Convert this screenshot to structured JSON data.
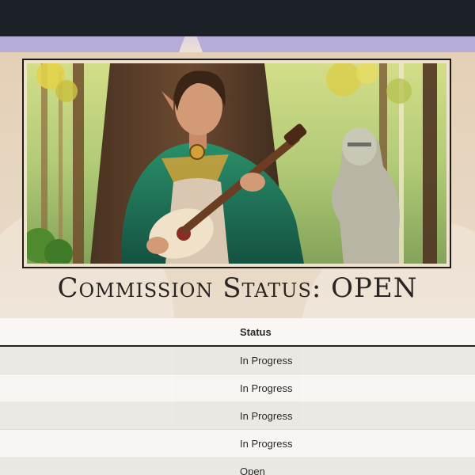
{
  "header": {
    "title": "Commission Status: OPEN"
  },
  "colors": {
    "topbar": "#1c2127",
    "accent_strip": "#b7abd8",
    "cloak_green": "#1f6b52",
    "gold": "#d2a238"
  },
  "illustration": {
    "description_icon": "bard-with-lute-illustration"
  },
  "table": {
    "columns": [
      "Status"
    ],
    "rows": [
      {
        "status": "In Progress"
      },
      {
        "status": "In Progress"
      },
      {
        "status": "In Progress"
      },
      {
        "status": "In Progress"
      },
      {
        "status": "Open"
      }
    ]
  }
}
